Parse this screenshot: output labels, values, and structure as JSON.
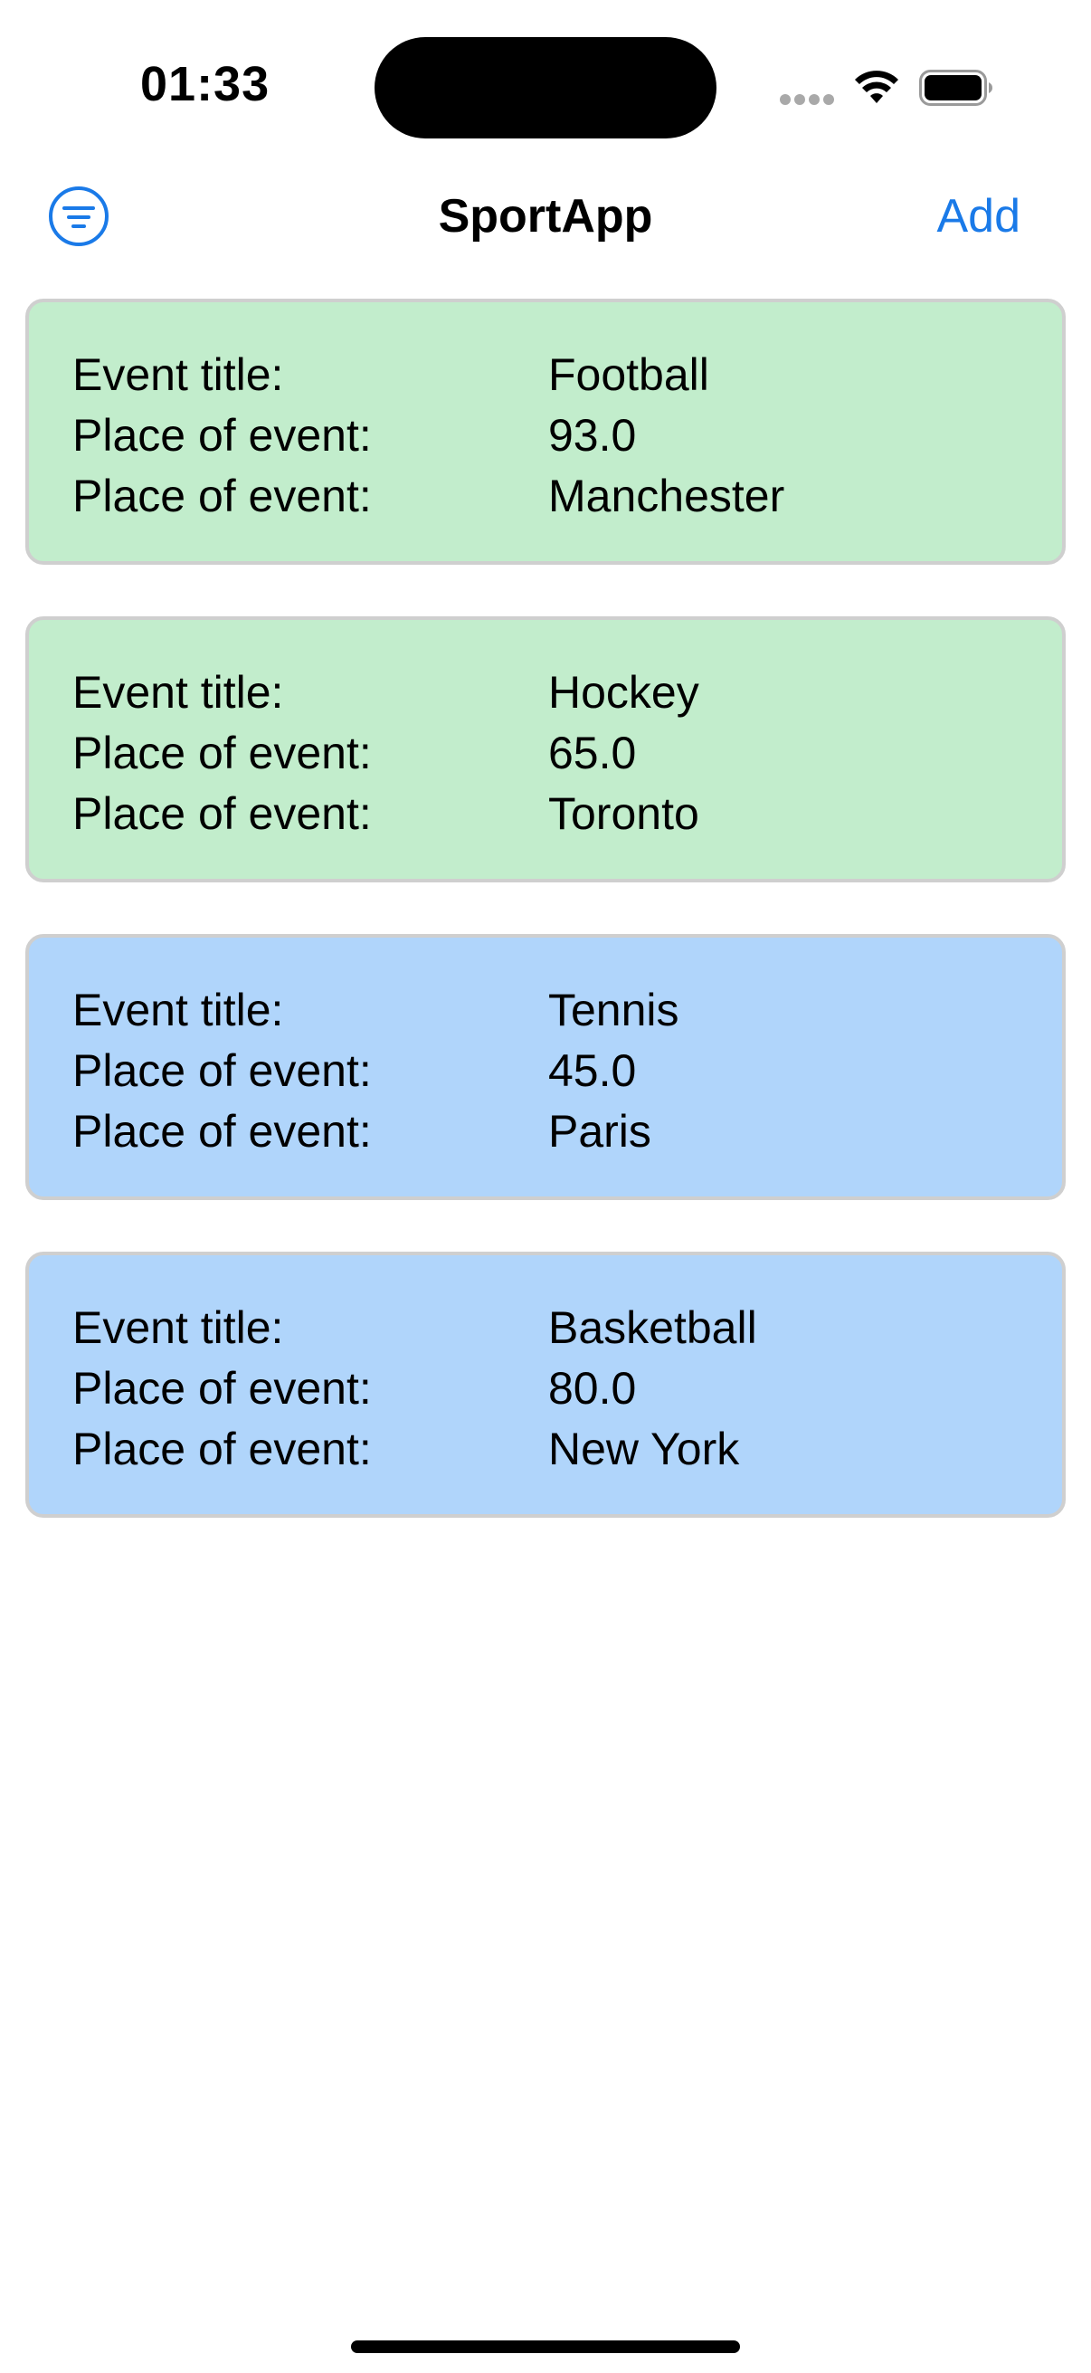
{
  "status_bar": {
    "time": "01:33",
    "icons": [
      "signal-dots-icon",
      "wifi-icon",
      "battery-icon"
    ]
  },
  "nav": {
    "title": "SportApp",
    "add_label": "Add",
    "filter_icon": "filter-icon",
    "accent_color": "#1a7ae8"
  },
  "events": [
    {
      "color": "#c2edcc",
      "rows": [
        {
          "label": "Event title:",
          "value": "Football"
        },
        {
          "label": "Place of event:",
          "value": "93.0"
        },
        {
          "label": "Place of event:",
          "value": "Manchester"
        }
      ]
    },
    {
      "color": "#c2edcc",
      "rows": [
        {
          "label": "Event title:",
          "value": "Hockey"
        },
        {
          "label": "Place of event:",
          "value": "65.0"
        },
        {
          "label": "Place of event:",
          "value": "Toronto"
        }
      ]
    },
    {
      "color": "#b0d5fb",
      "rows": [
        {
          "label": "Event title:",
          "value": "Tennis"
        },
        {
          "label": "Place of event:",
          "value": "45.0"
        },
        {
          "label": "Place of event:",
          "value": "Paris"
        }
      ]
    },
    {
      "color": "#b0d5fb",
      "rows": [
        {
          "label": "Event title:",
          "value": "Basketball"
        },
        {
          "label": "Place of event:",
          "value": "80.0"
        },
        {
          "label": "Place of event:",
          "value": "New York"
        }
      ]
    }
  ]
}
